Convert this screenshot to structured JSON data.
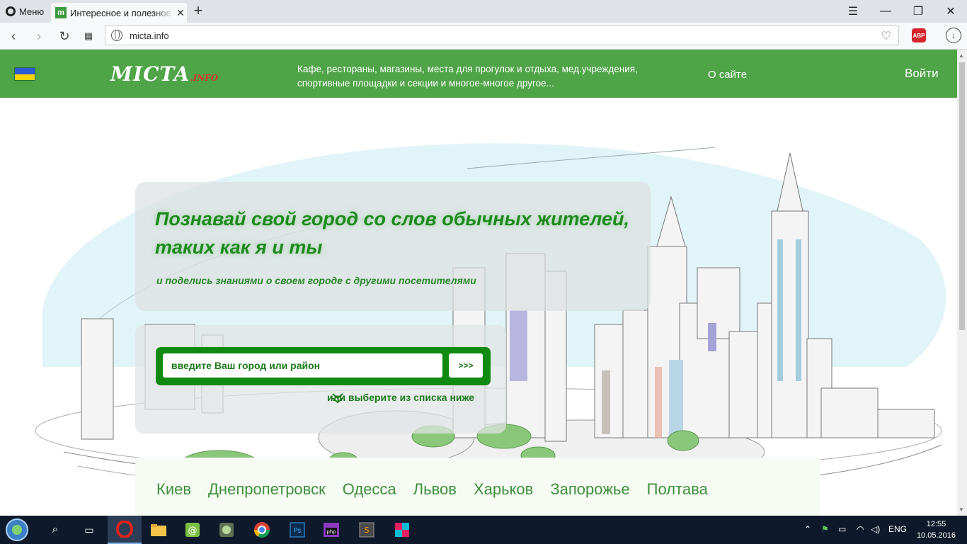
{
  "browser": {
    "menu_label": "Меню",
    "tab_title": "Интересное и полезное р",
    "tab_favicon": "m",
    "url": "micta.info",
    "abp_label": "ABP"
  },
  "site": {
    "logo_main": "MICTA",
    "logo_suffix": ".INFO",
    "tagline_line1": "Кафе, рестораны, магазины, места для прогулок и отдыха, мед.учреждения,",
    "tagline_line2": "спортивные площадки и секции и многое-многое другое...",
    "about_link": "О сайте",
    "login_link": "Войти",
    "colors": {
      "header_bg": "#4ea447",
      "accent": "#118a11",
      "flag_blue": "#2a5bd7",
      "flag_yellow": "#ffd500"
    }
  },
  "hero": {
    "headline_line1": "Познавай свой город со слов обычных жителей,",
    "headline_line2": "таких как я и ты",
    "subline": "и поделись знаниями о своем городе с другими посетителями",
    "search_placeholder": "введите Ваш город или район",
    "search_button": ">>>",
    "choose_text": "или выберите из списка ниже"
  },
  "cities": [
    "Киев",
    "Днепропетровск",
    "Одесса",
    "Львов",
    "Харьков",
    "Запорожье",
    "Полтава"
  ],
  "taskbar": {
    "lang": "ENG",
    "time": "12:55",
    "date": "10.05.2016"
  }
}
